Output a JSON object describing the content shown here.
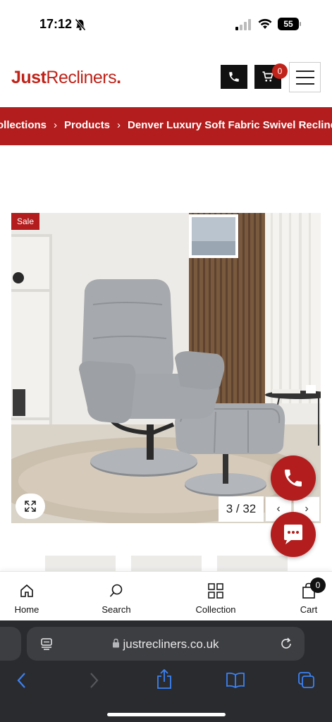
{
  "status_bar": {
    "time": "17:12",
    "battery": "55"
  },
  "header": {
    "logo_bold": "Just",
    "logo_light": "Recliners",
    "logo_dot": ".",
    "cart_count": "0"
  },
  "breadcrumb": {
    "items": [
      "ollections",
      "Products",
      "Denver Luxury Soft Fabric Swivel Recliner C"
    ],
    "separator": "›"
  },
  "product": {
    "badge": "Sale",
    "counter": "3 / 32",
    "prev_label": "‹",
    "next_label": "›"
  },
  "tabbar": {
    "tabs": [
      {
        "label": "Home",
        "icon": "home-icon"
      },
      {
        "label": "Search",
        "icon": "search-icon"
      },
      {
        "label": "Collection",
        "icon": "grid-icon"
      },
      {
        "label": "Cart",
        "icon": "bag-icon"
      }
    ],
    "cart_badge": "0"
  },
  "browser": {
    "url": "justrecliners.co.uk"
  },
  "colors": {
    "brand_red": "#b31d1d",
    "dark": "#111111",
    "browser_bg": "#2a2b2e",
    "ios_blue": "#3b82f6"
  }
}
